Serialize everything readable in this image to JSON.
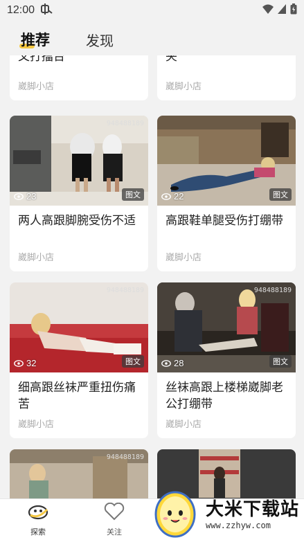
{
  "status_bar": {
    "time": "12:00"
  },
  "tabs": [
    {
      "label": "推荐",
      "active": true
    },
    {
      "label": "发现",
      "active": false
    }
  ],
  "cards": [
    {
      "title": "脚扭受伤绑带 又打擂台",
      "title_display": "又打擂台",
      "shop": "崴脚小店"
    },
    {
      "title": "夹",
      "title_display": "夹",
      "shop": "崴脚小店"
    },
    {
      "views": "23",
      "badge": "图文",
      "watermark": "948488189",
      "title": "两人高跟脚腕受伤不适",
      "shop": "崴脚小店"
    },
    {
      "views": "22",
      "badge": "图文",
      "title": "高跟鞋单腿受伤打绷带",
      "shop": "崴脚小店"
    },
    {
      "views": "32",
      "badge": "图文",
      "watermark": "948488189",
      "title": "细高跟丝袜严重扭伤痛苦",
      "shop": "崴脚小店"
    },
    {
      "views": "28",
      "badge": "图文",
      "watermark": "948488189",
      "title": "丝袜高跟上楼梯崴脚老公打绷带",
      "shop": "崴脚小店"
    },
    {
      "watermark": "948488189"
    },
    {}
  ],
  "bottom_nav": [
    {
      "label": "探索",
      "icon": "explore-icon",
      "active": true
    },
    {
      "label": "关注",
      "icon": "heart-icon",
      "active": false
    }
  ],
  "overlay": {
    "brand": "大米下载站",
    "url": "www.zzhyw.com"
  },
  "colors": {
    "accent": "#f5c842",
    "background": "#f2f2f2"
  }
}
